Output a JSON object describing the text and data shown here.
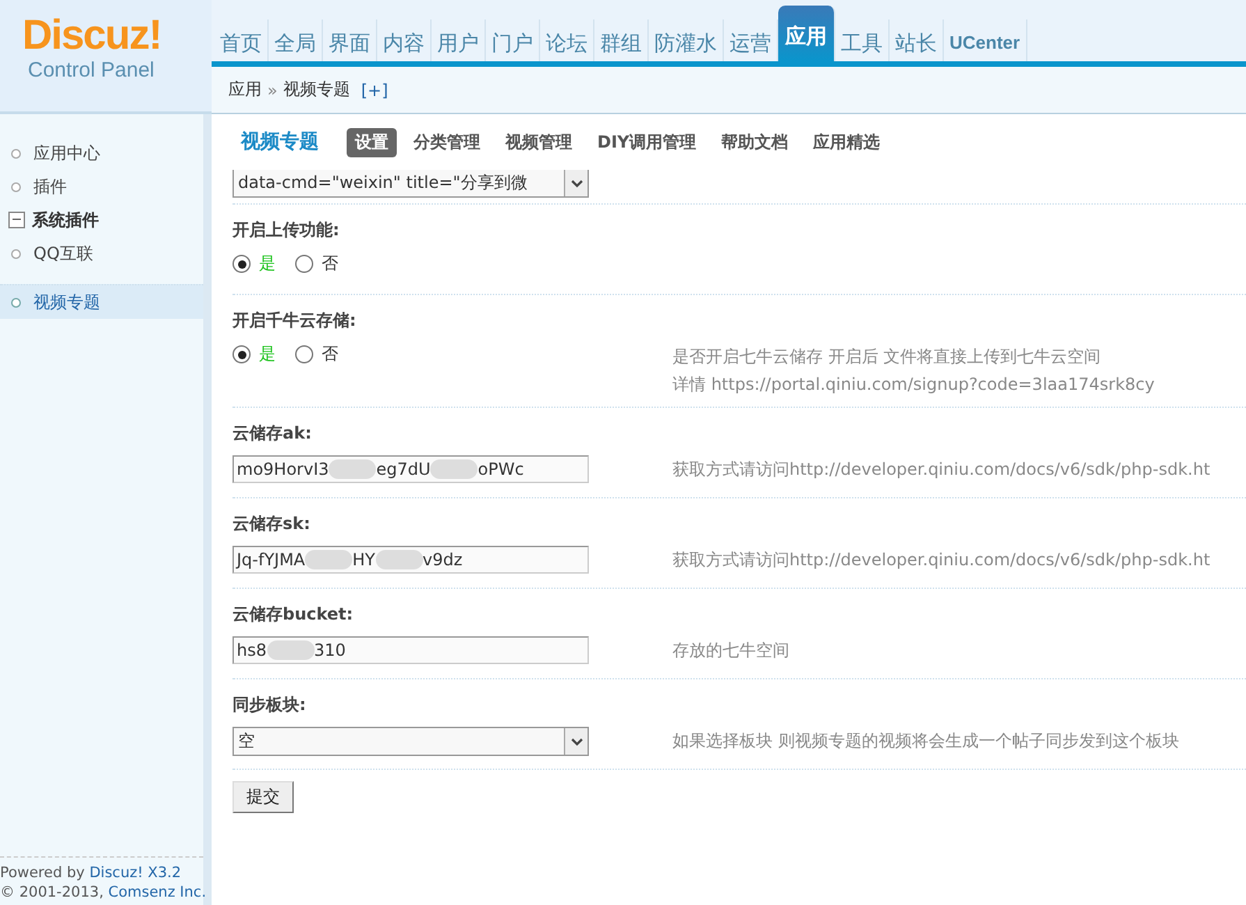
{
  "logo": {
    "name": "Discuz!",
    "subtitle": "Control Panel"
  },
  "nav": [
    {
      "label": "首页",
      "selected": false
    },
    {
      "label": "全局",
      "selected": false
    },
    {
      "label": "界面",
      "selected": false
    },
    {
      "label": "内容",
      "selected": false
    },
    {
      "label": "用户",
      "selected": false
    },
    {
      "label": "门户",
      "selected": false
    },
    {
      "label": "论坛",
      "selected": false
    },
    {
      "label": "群组",
      "selected": false
    },
    {
      "label": "防灌水",
      "selected": false
    },
    {
      "label": "运营",
      "selected": false
    },
    {
      "label": "应用",
      "selected": true
    },
    {
      "label": "工具",
      "selected": false
    },
    {
      "label": "站长",
      "selected": false
    },
    {
      "label": "UCenter",
      "selected": false
    }
  ],
  "breadcrumb": {
    "items": [
      "应用",
      "视频专题"
    ],
    "separator": "»",
    "add": "[+]"
  },
  "sidebar": {
    "items": [
      {
        "label": "应用中心",
        "kind": "link",
        "selected": false
      },
      {
        "label": "插件",
        "kind": "link",
        "selected": false
      },
      {
        "label": "系统插件",
        "kind": "group"
      },
      {
        "label": "QQ互联",
        "kind": "link",
        "selected": false
      },
      {
        "label": "视频专题",
        "kind": "link",
        "selected": true
      }
    ],
    "footer": {
      "powered": "Powered by",
      "product": "Discuz! X3.2",
      "copyright": "© 2001-2013,",
      "company": "Comsenz Inc."
    }
  },
  "page_title": "视频专题",
  "tabs": [
    {
      "label": "设置",
      "selected": true
    },
    {
      "label": "分类管理",
      "selected": false
    },
    {
      "label": "视频管理",
      "selected": false
    },
    {
      "label": "DIY调用管理",
      "selected": false
    },
    {
      "label": "帮助文档",
      "selected": false
    },
    {
      "label": "应用精选",
      "selected": false
    }
  ],
  "top_select": {
    "value": "data-cmd=\"weixin\" title=\"分享到微"
  },
  "settings": [
    {
      "kind": "radio",
      "label": "开启上传功能:",
      "options": [
        {
          "label": "是",
          "selected": true
        },
        {
          "label": "否",
          "selected": false
        }
      ]
    },
    {
      "kind": "radio",
      "label": "开启千牛云存储:",
      "options": [
        {
          "label": "是",
          "selected": true
        },
        {
          "label": "否",
          "selected": false
        }
      ],
      "help": [
        "是否开启七牛云储存 开启后 文件将直接上传到七牛云空间",
        "详情 https://portal.qiniu.com/signup?code=3laa174srk8cy"
      ]
    },
    {
      "kind": "text",
      "label": "云储存ak:",
      "value_parts": [
        "mo9HorvI3",
        "eg7dU",
        "oPWc"
      ],
      "help": [
        "获取方式请访问http://developer.qiniu.com/docs/v6/sdk/php-sdk.ht"
      ]
    },
    {
      "kind": "text",
      "label": "云储存sk:",
      "value_parts": [
        "Jq-fYJMA",
        "HY",
        "v9dz"
      ],
      "help": [
        "获取方式请访问http://developer.qiniu.com/docs/v6/sdk/php-sdk.ht"
      ]
    },
    {
      "kind": "text",
      "label": "云储存bucket:",
      "value_parts": [
        "hs8",
        "310"
      ],
      "help": [
        "存放的七牛空间"
      ]
    },
    {
      "kind": "select",
      "label": "同步板块:",
      "value": "空",
      "help": [
        "如果选择板块 则视频专题的视频将会生成一个帖子同步发到这个板块"
      ]
    }
  ],
  "submit": "提交"
}
